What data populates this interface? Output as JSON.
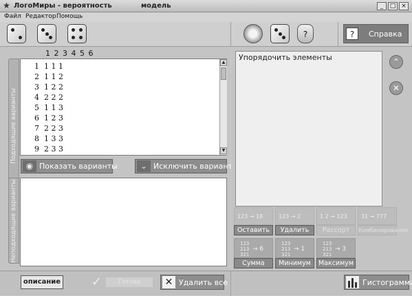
{
  "window": {
    "title": "ЛогоМиры - вероятность",
    "subtitle": "модель",
    "buttons": [
      "_",
      "□",
      "×"
    ]
  },
  "menu": [
    {
      "label": "Файл"
    },
    {
      "label": "Редактор"
    },
    {
      "label": "Помощь"
    }
  ],
  "toolbar": {
    "help_label": "Справка",
    "help_icon": "?"
  },
  "header_digits": "1 2 3 4 5 6",
  "suitable": {
    "tab_label": "Подходящие варианты",
    "rows": [
      "1  1 1 1",
      "2  1 1 2",
      "3  1 2 2",
      "4  2 2 2",
      "5  1 1 3",
      "6  1 2 3",
      "7  2 2 3",
      "8  1 3 3",
      "9  2 3 3"
    ]
  },
  "buttons": {
    "show_variants": "Показать варианты",
    "exclude_variant": "Исключить вариант"
  },
  "unsuitable": {
    "tab_label": "Неподходящие варианты"
  },
  "right": {
    "order_label": "Упорядочить элементы",
    "tiles_row1": [
      "123 → 18",
      "123 → 2",
      "1 2 → 123",
      "31 → 777"
    ],
    "leave": "Оставить",
    "delete": "Удалить",
    "sort": "Рассорт",
    "combine": "Комбинирование",
    "tiles_row2": [
      {
        "lines": "123\n213\n321",
        "result": "→ 6"
      },
      {
        "lines": "123\n213\n321",
        "result": "→ 1"
      },
      {
        "lines": "123\n213\n321",
        "result": "→ 3"
      }
    ],
    "sum": "Сумма",
    "min": "Минимум",
    "max": "Максимум"
  },
  "bottom": {
    "description": "описание",
    "apply": "Готово",
    "delete_all": "Удалить все",
    "histogram": "Гистограмма"
  }
}
